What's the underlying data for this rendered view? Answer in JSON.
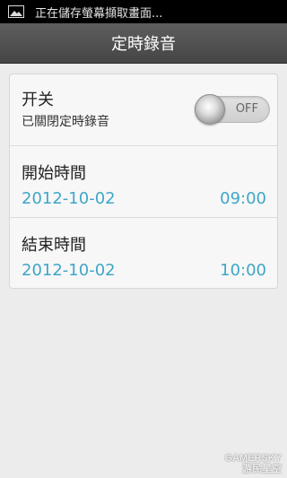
{
  "status_bar": {
    "notification_text": "正在儲存螢幕擷取畫面...",
    "icon": "image-icon"
  },
  "header": {
    "title": "定時錄音"
  },
  "switch_row": {
    "title": "开关",
    "subtitle": "已關閉定時錄音",
    "toggle_label": "OFF",
    "toggle_state": "off"
  },
  "start_row": {
    "title": "開始時間",
    "date": "2012-10-02",
    "time": "09:00"
  },
  "end_row": {
    "title": "結束時間",
    "date": "2012-10-02",
    "time": "10:00"
  },
  "watermark": {
    "line1": "GAMERSKY",
    "line2": "游民星空"
  },
  "colors": {
    "accent": "#3fa6c8",
    "title_bar": "#4f4f4f",
    "background": "#ececec"
  }
}
